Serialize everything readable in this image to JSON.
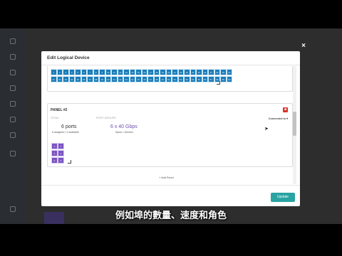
{
  "modal": {
    "title": "Edit Logical Device",
    "close_icon": "close-icon",
    "add_panel_label": "+ Add Panel",
    "update_label": "Update"
  },
  "panel1": {
    "row1": [
      "1",
      "2",
      "3",
      "4",
      "5",
      "6",
      "7",
      "8",
      "9",
      "10",
      "11",
      "12",
      "13",
      "14",
      "15",
      "16",
      "17",
      "18",
      "19",
      "20",
      "21",
      "22",
      "23",
      "24",
      "25",
      "26",
      "27",
      "28",
      "29",
      "30"
    ],
    "row2": [
      "31",
      "32",
      "33",
      "34",
      "35",
      "36",
      "37",
      "38",
      "39",
      "40",
      "41",
      "42",
      "43",
      "44",
      "45",
      "46",
      "47",
      "48",
      "49",
      "50",
      "51",
      "52",
      "53",
      "54",
      "55",
      "56",
      "57",
      "58",
      "59",
      "60"
    ]
  },
  "panel2": {
    "title": "PANEL #2",
    "total_label": "TOTAL",
    "groups_label": "PORT GROUPS",
    "connected_label": "Connected to",
    "ports_count": "6 ports",
    "ports_detail": "6 assigned • 0 available",
    "group_speed": "6 x 40 Gbps",
    "group_roles": "Spine • Generic",
    "grid": [
      [
        "1",
        "2"
      ],
      [
        "3",
        "4"
      ],
      [
        "5",
        "6"
      ]
    ]
  },
  "subtitle": "例如埠的數量、速度和角色",
  "colors": {
    "port_blue": "#1a7cb8",
    "port_purple": "#7b55c4",
    "update_teal": "#2aa3a3",
    "delete_red": "#d9342b"
  }
}
